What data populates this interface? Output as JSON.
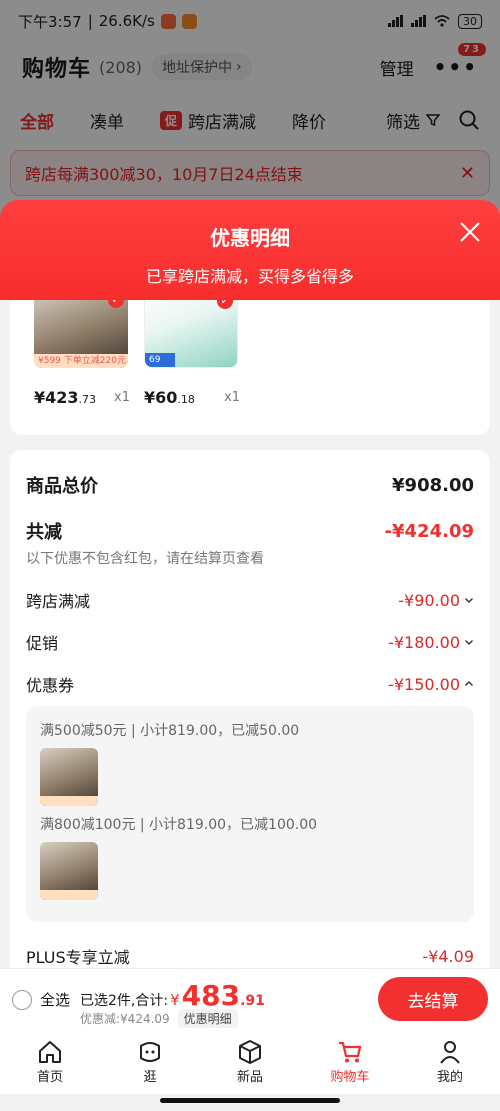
{
  "status_bar": {
    "time": "下午3:57",
    "speed": "26.6K/s",
    "battery": "30"
  },
  "header": {
    "title": "购物车",
    "count": "(208)",
    "address_chip": "地址保护中",
    "manage": "管理",
    "more_badge": "73"
  },
  "tabs": [
    {
      "label": "全部",
      "active": true
    },
    {
      "label": "凑单"
    },
    {
      "label": "跨店满减",
      "tag": "促"
    },
    {
      "label": "降价"
    },
    {
      "label": "筛选"
    }
  ],
  "promo_banner": {
    "text": "跨店每满300减30，10月7日24点结束"
  },
  "sheet": {
    "title": "优惠明细",
    "subtitle": "已享跨店满减，买得多省得多",
    "products": [
      {
        "price_int": "¥423",
        "price_dec": ".73",
        "qty": "x1",
        "strip": "¥599 下单立减220元"
      },
      {
        "price_int": "¥60",
        "price_dec": ".18",
        "qty": "x1",
        "strip": "69"
      }
    ],
    "summary": {
      "total_label": "商品总价",
      "total_value": "¥908.00",
      "reduce_label": "共减",
      "reduce_value": "-¥424.09",
      "note": "以下优惠不包含红包，请在结算页查看",
      "lines": [
        {
          "label": "跨店满减",
          "value": "-¥90.00"
        },
        {
          "label": "促销",
          "value": "-¥180.00"
        },
        {
          "label": "优惠券",
          "value": "-¥150.00"
        }
      ],
      "coupons": [
        {
          "text": "满500减50元 | 小计819.00，已减50.00"
        },
        {
          "text": "满800减100元 | 小计819.00，已减100.00"
        }
      ],
      "plus_label": "PLUS专享立减",
      "plus_value": "-¥4.09"
    }
  },
  "checkout": {
    "select_all": "全选",
    "selected": "已选2件,合计:",
    "currency": "¥",
    "total_int": "483",
    "total_dec": ".91",
    "saved": "优惠减:¥424.09",
    "detail_chip": "优惠明细",
    "pay": "去结算"
  },
  "tabbar": [
    {
      "label": "首页",
      "icon": "home-icon"
    },
    {
      "label": "逛",
      "icon": "face-icon"
    },
    {
      "label": "新品",
      "icon": "cube-icon"
    },
    {
      "label": "购物车",
      "icon": "cart-icon",
      "active": true
    },
    {
      "label": "我的",
      "icon": "user-icon"
    }
  ],
  "colors": {
    "accent": "#f23030"
  }
}
